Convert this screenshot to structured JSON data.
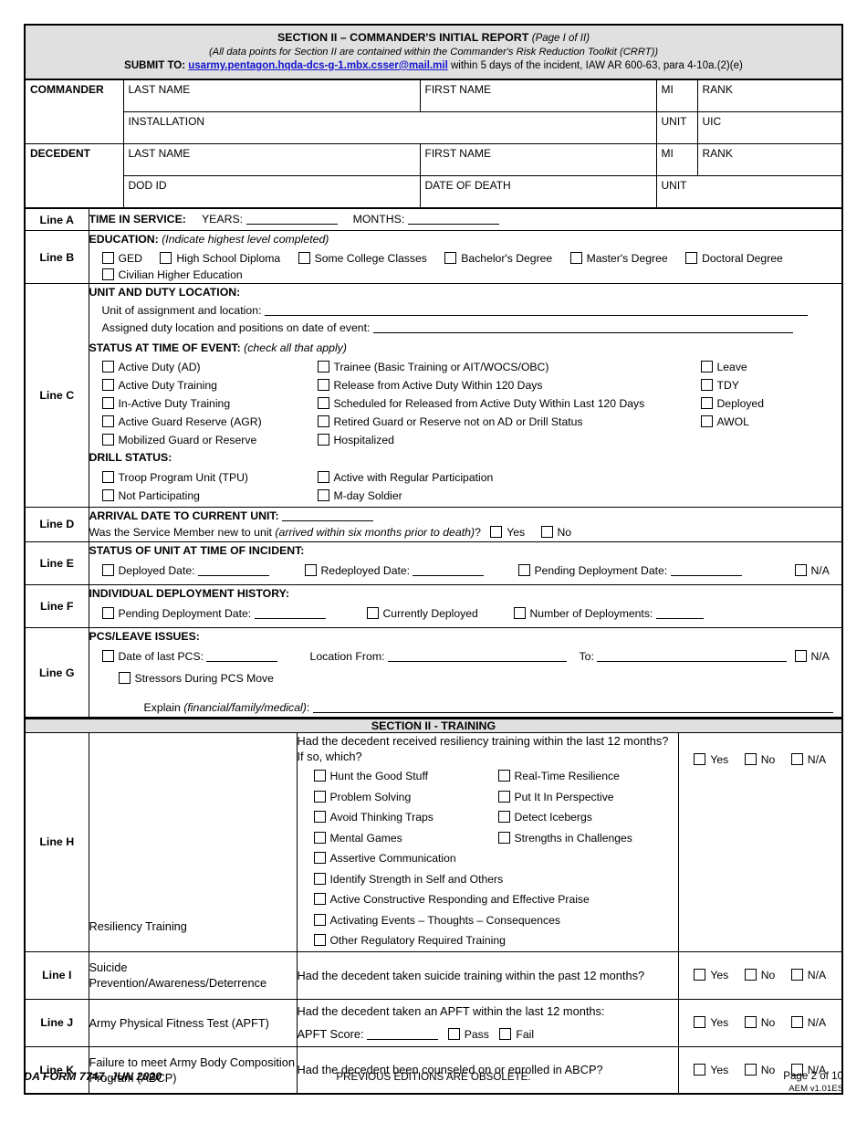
{
  "header": {
    "title_main": "SECTION II – COMMANDER'S INITIAL REPORT",
    "title_paren": "(Page I of II)",
    "subtitle": "(All data points for Section II are contained within the Commander's Risk Reduction Toolkit (CRRT))",
    "submit_label": "SUBMIT TO:",
    "submit_email": "usarmy.pentagon.hqda-dcs-g-1.mbx.csser@mail.mil",
    "submit_rest": " within 5 days of the incident, IAW AR 600-63, para 4-10a.(2)(e)",
    "link_color": "#1414d0",
    "banner_bg": "#e0e0e0"
  },
  "commander": {
    "row_label": "COMMANDER",
    "last_name": "LAST NAME",
    "first_name": "FIRST NAME",
    "mi": "MI",
    "rank": "RANK",
    "installation": "INSTALLATION",
    "unit": "UNIT",
    "uic": "UIC"
  },
  "decedent": {
    "row_label": "DECEDENT",
    "last_name": "LAST NAME",
    "first_name": "FIRST NAME",
    "mi": "MI",
    "rank": "RANK",
    "dod_id": "DOD ID",
    "date_of_death": "DATE OF DEATH",
    "unit": "UNIT"
  },
  "line_a": {
    "label": "Line A",
    "title": "TIME IN SERVICE:",
    "years_label": "YEARS:",
    "months_label": "MONTHS:"
  },
  "line_b": {
    "label": "Line B",
    "title": "EDUCATION:",
    "note": "(Indicate highest level completed)",
    "options": [
      "GED",
      "High School Diploma",
      "Some College Classes",
      "Bachelor's Degree",
      "Master's Degree",
      "Doctoral Degree",
      "Civilian Higher Education"
    ]
  },
  "line_c": {
    "label": "Line C",
    "title": "UNIT AND DUTY LOCATION:",
    "field_unit_assignment": "Unit of assignment and location:",
    "field_assigned_duty": "Assigned duty location and positions on date of event:",
    "status_title": "STATUS AT TIME OF EVENT:",
    "status_note": "(check all that apply)",
    "status_col1": [
      "Active Duty (AD)",
      "Active Duty Training",
      "In-Active Duty Training",
      "Active Guard Reserve (AGR)",
      "Mobilized Guard or Reserve"
    ],
    "status_col2": [
      "Trainee (Basic Training or AIT/WOCS/OBC)",
      "Release from Active Duty Within 120 Days",
      "Scheduled for Released from Active Duty Within Last 120 Days",
      "Retired Guard or Reserve not on AD or Drill Status",
      "Hospitalized"
    ],
    "status_col3": [
      "Leave",
      "TDY",
      "Deployed",
      "AWOL"
    ],
    "drill_title": "DRILL STATUS:",
    "drill_col1": [
      "Troop Program Unit (TPU)",
      "Not Participating"
    ],
    "drill_col2": [
      "Active with Regular Participation",
      "M-day Soldier"
    ]
  },
  "line_d": {
    "label": "Line D",
    "title": "ARRIVAL DATE TO CURRENT UNIT:",
    "question_a": "Was the Service Member new to unit ",
    "question_ital": "(arrived within six months prior to death)",
    "question_b": "?",
    "yes": "Yes",
    "no": "No"
  },
  "line_e": {
    "label": "Line E",
    "title": "STATUS OF UNIT AT TIME OF INCIDENT:",
    "deployed_date": "Deployed Date:",
    "redeployed_date": "Redeployed Date:",
    "pending_deployment_date": "Pending Deployment Date:",
    "na": "N/A"
  },
  "line_f": {
    "label": "Line F",
    "title": "INDIVIDUAL DEPLOYMENT HISTORY:",
    "pending_deployment_date": "Pending Deployment Date:",
    "currently_deployed": "Currently Deployed",
    "number_of_deployments": "Number of Deployments:"
  },
  "line_g": {
    "label": "Line G",
    "title": "PCS/LEAVE ISSUES:",
    "date_of_last_pcs": "Date of last PCS:",
    "location_from": "Location From:",
    "to": "To:",
    "na": "N/A",
    "stressors": "Stressors During PCS Move",
    "explain": "Explain ",
    "explain_ital": "(financial/family/medical)",
    "explain_colon": ":"
  },
  "training_section": {
    "bar_title": "SECTION II - TRAINING"
  },
  "line_h": {
    "label": "Line H",
    "category": "Resiliency Training",
    "question": "Had the decedent received resiliency training within the last 12 months? If so, which?",
    "options_left": [
      "Hunt the Good Stuff",
      "Problem Solving",
      "Avoid Thinking Traps",
      "Mental Games",
      "Assertive Communication"
    ],
    "options_right": [
      "Real-Time Resilience",
      "Put It In Perspective",
      "Detect Icebergs",
      "Strengths in Challenges",
      "Identify Strength in Self and Others"
    ],
    "options_full": [
      "Active Constructive Responding and Effective Praise",
      "Activating Events – Thoughts – Consequences",
      "Other Regulatory Required Training"
    ],
    "answers": [
      "Yes",
      "No",
      "N/A"
    ]
  },
  "line_i": {
    "label": "Line I",
    "category": "Suicide Prevention/Awareness/Deterrence",
    "question": "Had the decedent taken suicide training within the past 12 months?",
    "answers": [
      "Yes",
      "No",
      "N/A"
    ]
  },
  "line_j": {
    "label": "Line J",
    "category": "Army Physical Fitness Test (APFT)",
    "question": "Had the decedent taken an APFT within the last 12 months:",
    "score_label": "APFT Score:",
    "pass": "Pass",
    "fail": "Fail",
    "answers": [
      "Yes",
      "No",
      "N/A"
    ]
  },
  "line_k": {
    "label": "Line K",
    "category": "Failure to meet Army Body Composition Program (ABCP)",
    "question": "Had the decedent been counseled on or enrolled in ABCP?",
    "answers": [
      "Yes",
      "No",
      "N/A"
    ]
  },
  "footer": {
    "form_id": "DA FORM 7747, JUN 2020",
    "center": "PREVIOUS EDITIONS ARE OBSOLETE.",
    "page": "Page 2 of 10",
    "version": "AEM v1.01ES"
  }
}
